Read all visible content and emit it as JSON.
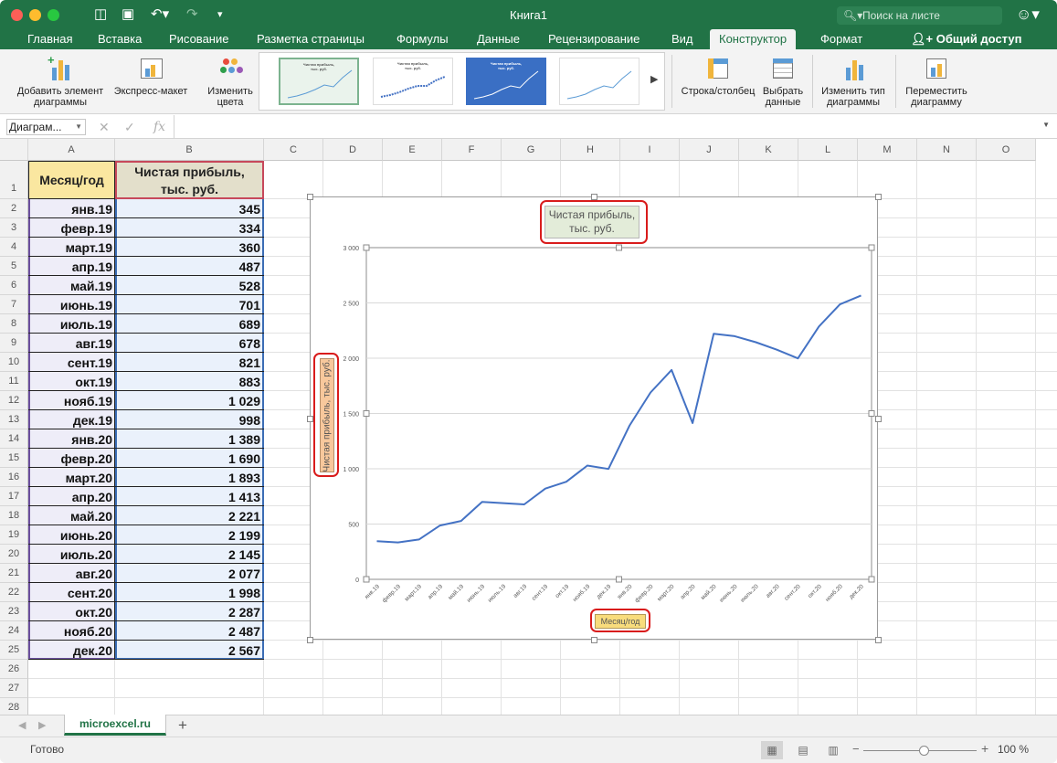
{
  "window": {
    "title": "Книга1",
    "search_placeholder": "Поиск на листе"
  },
  "ribbon_tabs": [
    "Главная",
    "Вставка",
    "Рисование",
    "Разметка страницы",
    "Формулы",
    "Данные",
    "Рецензирование",
    "Вид",
    "Конструктор",
    "Формат"
  ],
  "active_tab": "Конструктор",
  "share_label": "Общий доступ",
  "ribbon": {
    "add_element": [
      "Добавить элемент",
      "диаграммы"
    ],
    "express_layout": "Экспресс-макет",
    "change_colors": [
      "Изменить",
      "цвета"
    ],
    "row_col": "Строка/столбец",
    "select_data": [
      "Выбрать",
      "данные"
    ],
    "change_type": [
      "Изменить тип",
      "диаграммы"
    ],
    "move_chart": [
      "Переместить",
      "диаграмму"
    ],
    "style_thumb_title": [
      "Чистая прибыль,",
      "тыс. руб."
    ]
  },
  "formula_bar": {
    "name_box": "Диаграм...",
    "fx": "fx"
  },
  "columns": [
    "A",
    "B",
    "C",
    "D",
    "E",
    "F",
    "G",
    "H",
    "I",
    "J",
    "K",
    "L",
    "M",
    "N",
    "O"
  ],
  "rows": [
    "1",
    "2",
    "3",
    "4",
    "5",
    "6",
    "7",
    "8",
    "9",
    "10",
    "11",
    "12",
    "13",
    "14",
    "15",
    "16",
    "17",
    "18",
    "19",
    "20",
    "21",
    "22",
    "23",
    "24",
    "25",
    "26",
    "27",
    "28"
  ],
  "table": {
    "header_a": "Месяц/год",
    "header_b": [
      "Чистая прибыль,",
      "тыс. руб."
    ],
    "months": [
      "янв.19",
      "февр.19",
      "март.19",
      "апр.19",
      "май.19",
      "июнь.19",
      "июль.19",
      "авг.19",
      "сент.19",
      "окт.19",
      "нояб.19",
      "дек.19",
      "янв.20",
      "февр.20",
      "март.20",
      "апр.20",
      "май.20",
      "июнь.20",
      "июль.20",
      "авг.20",
      "сент.20",
      "окт.20",
      "нояб.20",
      "дек.20"
    ],
    "values_text": [
      "345",
      "334",
      "360",
      "487",
      "528",
      "701",
      "689",
      "678",
      "821",
      "883",
      "1 029",
      "998",
      "1 389",
      "1 690",
      "1 893",
      "1 413",
      "2 221",
      "2 199",
      "2 145",
      "2 077",
      "1 998",
      "2 287",
      "2 487",
      "2 567"
    ]
  },
  "chart_data": {
    "type": "line",
    "title": "Чистая прибыль, тыс. руб.",
    "title_lines": [
      "Чистая прибыль,",
      "тыс. руб."
    ],
    "xlabel": "Месяц/год",
    "ylabel": "Чистая прибыль, тыс. руб.",
    "ylim": [
      0,
      3000
    ],
    "yticks": [
      "0",
      "500",
      "1 000",
      "1 500",
      "2 000",
      "2 500",
      "3 000"
    ],
    "grid": true,
    "line_color": "#4472c4",
    "categories": [
      "янв.19",
      "февр.19",
      "март.19",
      "апр.19",
      "май.19",
      "июнь.19",
      "июль.19",
      "авг.19",
      "сент.19",
      "окт.19",
      "нояб.19",
      "дек.19",
      "янв.20",
      "февр.20",
      "март.20",
      "апр.20",
      "май.20",
      "июнь.20",
      "июль.20",
      "авг.20",
      "сент.20",
      "окт.20",
      "нояб.20",
      "дек.20"
    ],
    "values": [
      345,
      334,
      360,
      487,
      528,
      701,
      689,
      678,
      821,
      883,
      1029,
      998,
      1389,
      1690,
      1893,
      1413,
      2221,
      2199,
      2145,
      2077,
      1998,
      2287,
      2487,
      2567
    ]
  },
  "sheet_tab": "microexcel.ru",
  "status": {
    "ready": "Готово",
    "zoom": "100 %"
  },
  "colors": {
    "accent": "#217346",
    "highlight": "#d91c1c"
  }
}
